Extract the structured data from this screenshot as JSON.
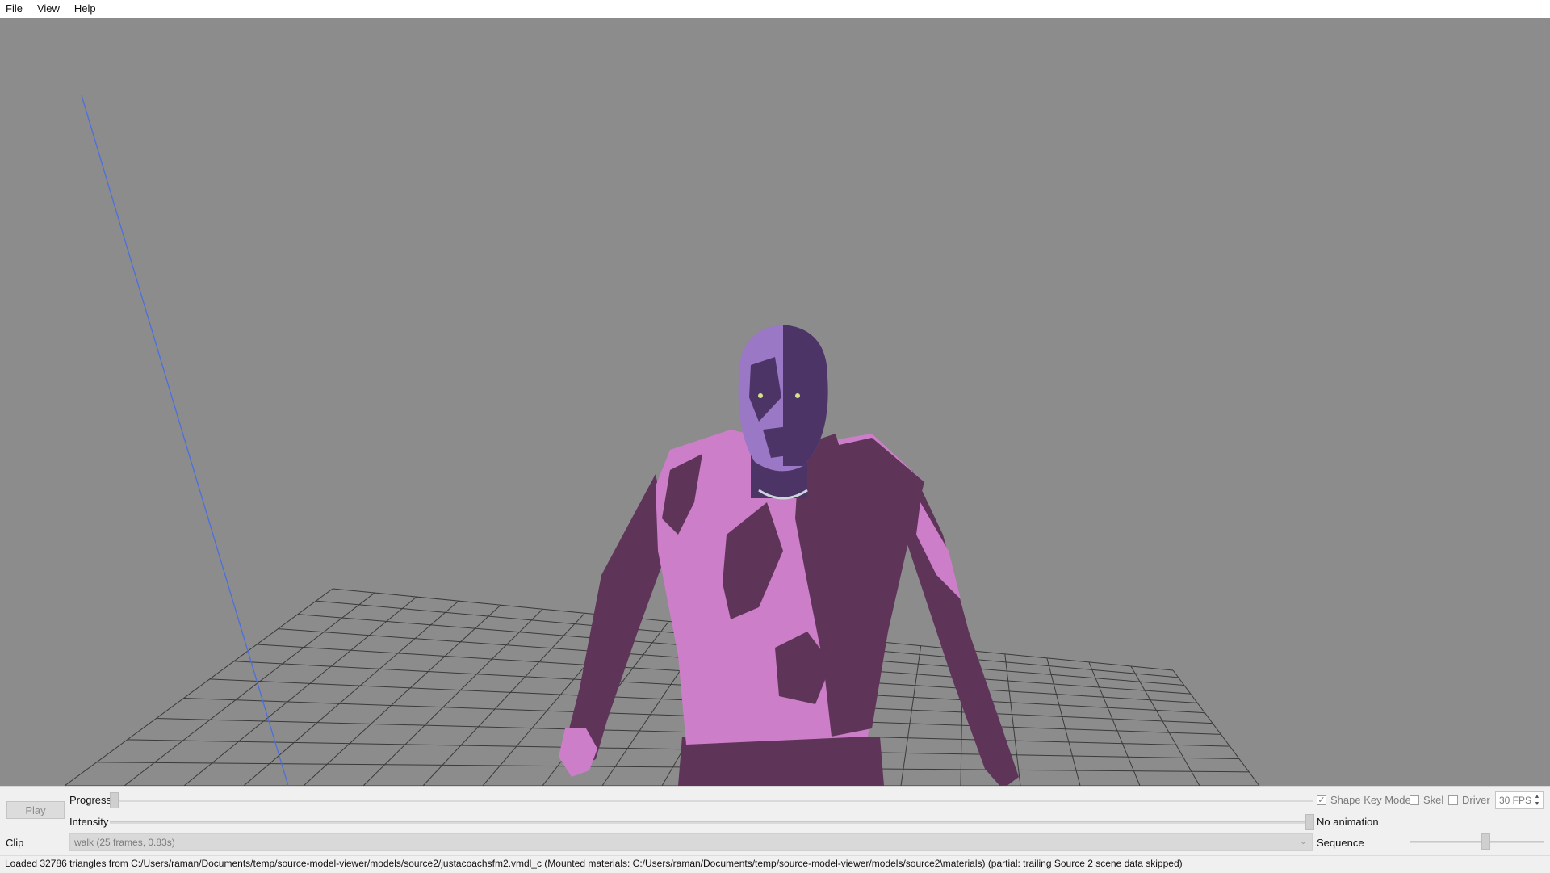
{
  "menu": {
    "items": [
      "File",
      "View",
      "Help"
    ]
  },
  "controls": {
    "play_label": "Play",
    "progress_label": "Progress",
    "intensity_label": "Intensity",
    "clip_label": "Clip",
    "clip_value": "walk (25 frames, 0.83s)",
    "progress": 0,
    "intensity": 1,
    "shape_key_mode": {
      "label": "Shape Key Mode",
      "checked": true
    },
    "skel": {
      "label": "Skel",
      "checked": false
    },
    "driver": {
      "label": "Driver",
      "checked": false
    },
    "fps_value": "30 FPS",
    "animation_status": "No animation",
    "sequence_label": "Sequence",
    "sequence_level": 0.57
  },
  "status": {
    "text": "Loaded 32786 triangles from C:/Users/raman/Documents/temp/source-model-viewer/models/source2/justacoachsfm2.vmdl_c (Mounted materials: C:/Users/raman/Documents/temp/source-model-viewer/models/source2\\materials) (partial: trailing Source 2 scene data skipped)"
  },
  "colors": {
    "viewport_bg": "#8c8c8c",
    "grid_line": "#3a3a3a",
    "axis_line": "#4b6fe0",
    "model_light": "#cc7ec8",
    "model_dark": "#5e3459",
    "head_light": "#9a78c6",
    "head_dark": "#4d3466"
  }
}
